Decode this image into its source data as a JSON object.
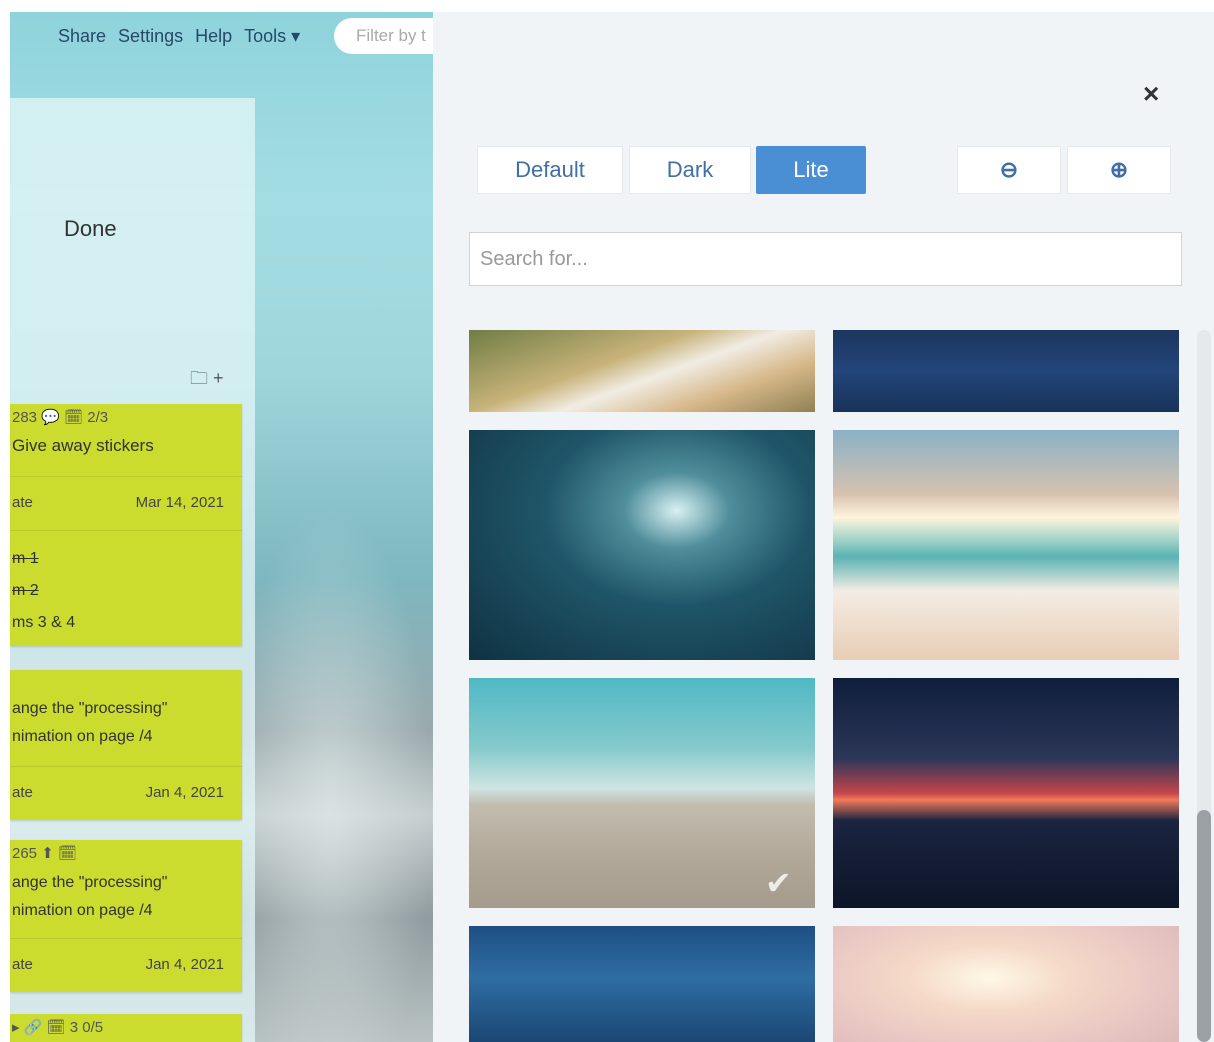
{
  "topbar": {
    "links": [
      "Share",
      "Settings",
      "Help",
      "Tools ▾"
    ],
    "filter_placeholder": "Filter by t"
  },
  "column": {
    "title": "Done",
    "icons": "🗀 +"
  },
  "cards": [
    {
      "meta": "283 💬 🗓 2/3",
      "title": "Give away stickers",
      "row_left": "ate",
      "row_right": "Mar 14, 2021",
      "checklist": [
        "m 1",
        "m 2",
        "ms 3 & 4"
      ]
    },
    {
      "line1": "ange the \"processing\"",
      "line2": "nimation on page /4",
      "row_left": "ate",
      "row_right": "Jan 4, 2021"
    },
    {
      "meta": "265 ⬆ 🗓",
      "line1": "ange the \"processing\"",
      "line2": "nimation on page /4",
      "row_left": "ate",
      "row_right": "Jan 4, 2021"
    },
    {
      "meta": "▸ 🔗 🗓 3 0/5"
    }
  ],
  "panel": {
    "close": "×",
    "theme_buttons": [
      "Default",
      "Dark",
      "Lite"
    ],
    "active_theme": "Lite",
    "zoom_out": "⊖",
    "zoom_in": "⊕",
    "search_placeholder": "Search for...",
    "selected_check": "✔"
  },
  "colors": {
    "accent": "#4a8fd3",
    "card": "#cbdc2e"
  }
}
